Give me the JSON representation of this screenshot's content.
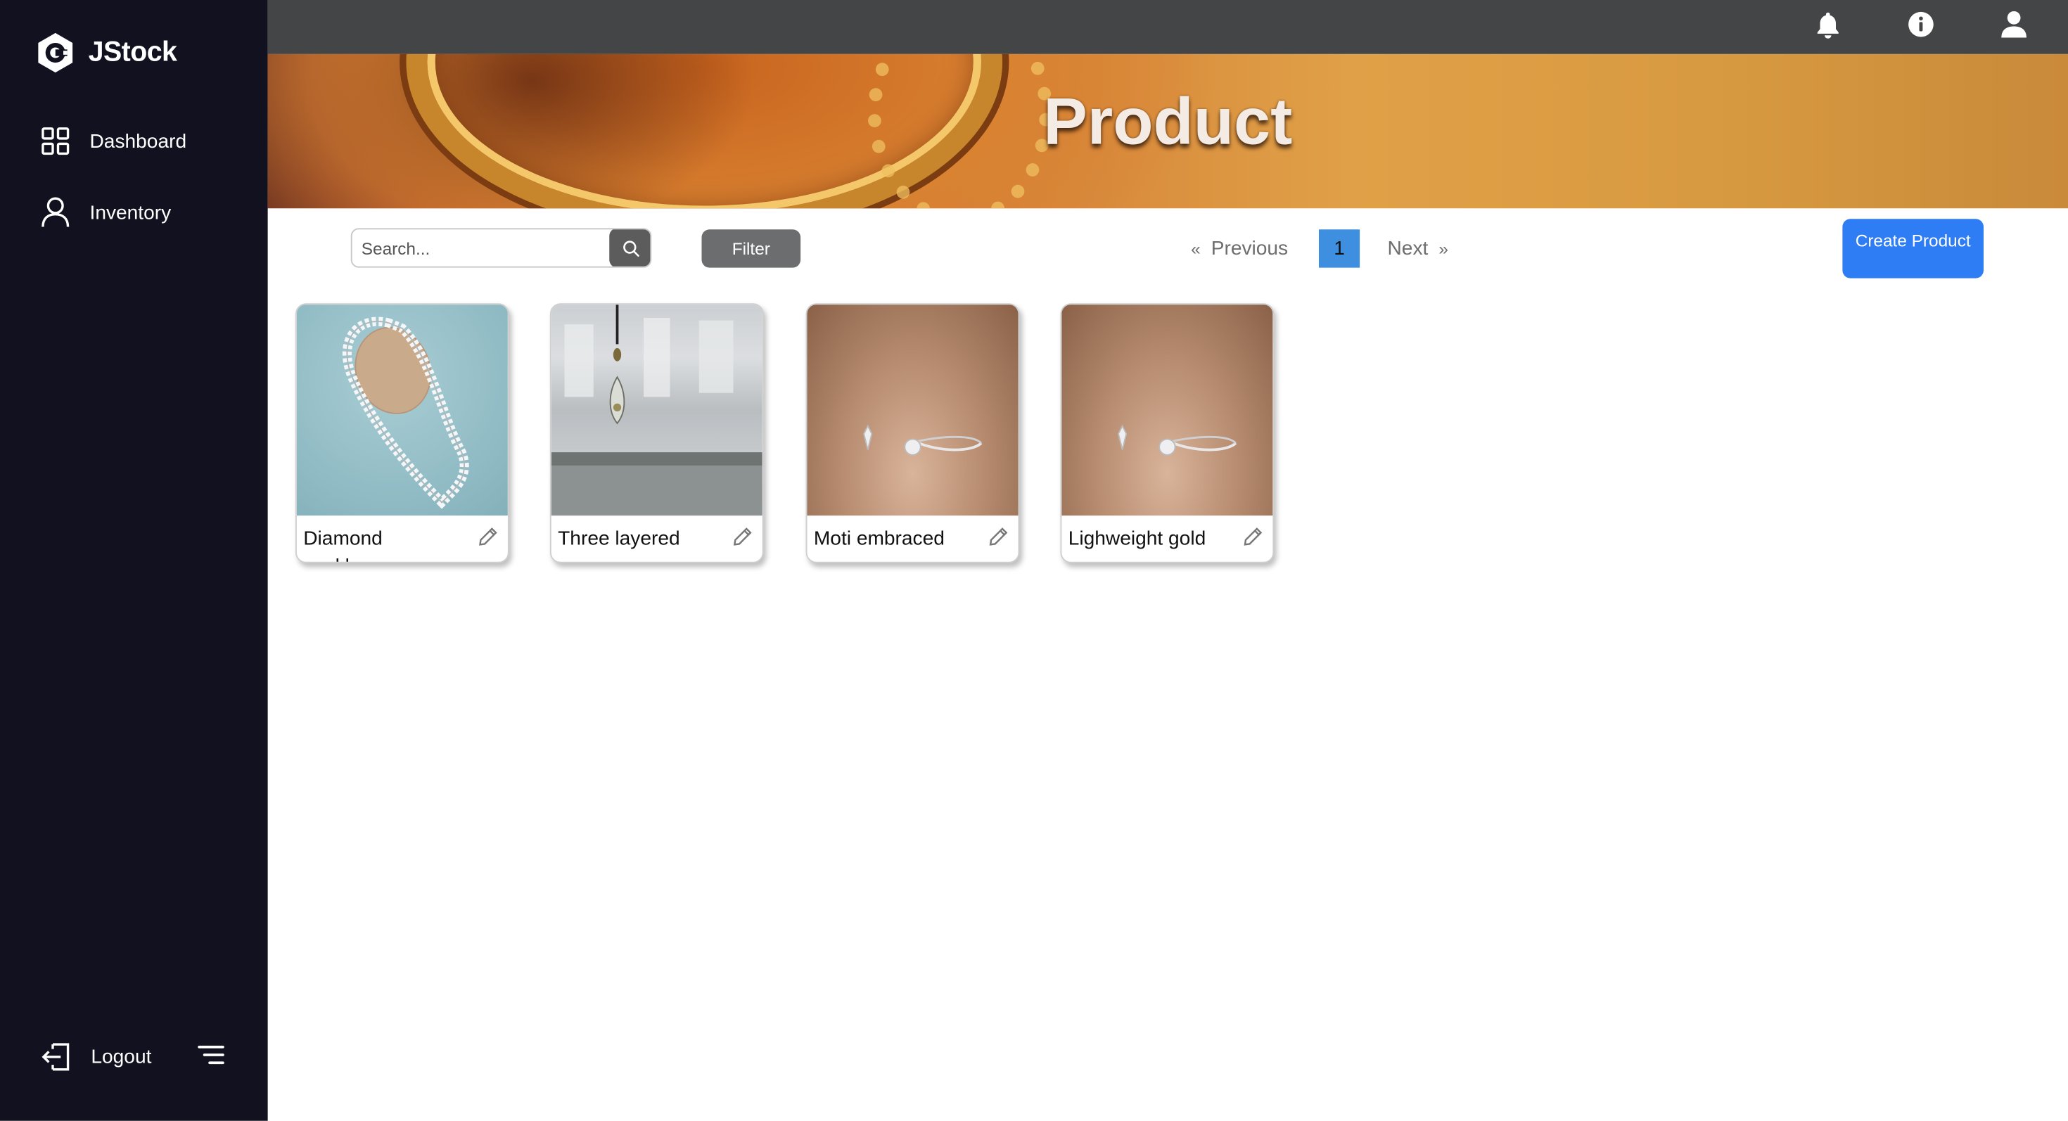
{
  "app": {
    "name": "JStock"
  },
  "sidebar": {
    "items": [
      {
        "label": "Dashboard",
        "icon": "grid-icon"
      },
      {
        "label": "Inventory",
        "icon": "user-icon"
      }
    ],
    "logout_label": "Logout"
  },
  "topbar": {
    "icons": [
      "bell-icon",
      "info-icon",
      "user-icon"
    ]
  },
  "banner": {
    "title": "Product"
  },
  "toolbar": {
    "search_placeholder": "Search...",
    "filter_label": "Filter",
    "create_label": "Create Product"
  },
  "pagination": {
    "previous_label": "Previous",
    "next_label": "Next",
    "current_page": "1"
  },
  "products": [
    {
      "name": "Diamond necklace"
    },
    {
      "name": "Three layered"
    },
    {
      "name": "Moti embraced"
    },
    {
      "name": "Lighweight gold"
    }
  ],
  "colors": {
    "sidebar": "#12111f",
    "topbar": "#444546",
    "accent": "#2f7df4",
    "page_active": "#3e8fe0",
    "filter": "#6c6d6e"
  }
}
